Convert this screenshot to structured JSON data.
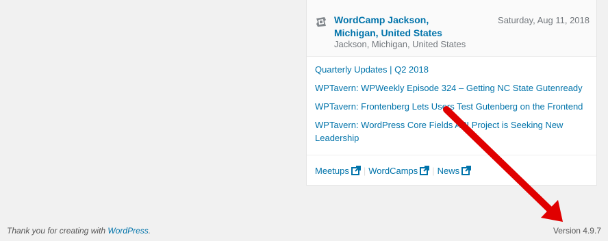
{
  "event": {
    "icon": "wordcamp-icon",
    "title": "WordCamp Jackson, Michigan, United States",
    "location": "Jackson, Michigan, United States",
    "date": "Saturday, Aug 11, 2018"
  },
  "news": [
    "Quarterly Updates | Q2 2018",
    "WPTavern: WPWeekly Episode 324 – Getting NC State Gutenready",
    "WPTavern: Frontenberg Lets Users Test Gutenberg on the Frontend",
    "WPTavern: WordPress Core Fields API Project is Seeking New Leadership"
  ],
  "links": {
    "meetups": "Meetups",
    "wordcamps": "WordCamps",
    "news": "News",
    "separator": "|",
    "icon": "external-link-icon"
  },
  "footer": {
    "thanks_prefix": "Thank you for creating with ",
    "thanks_link": "WordPress",
    "thanks_suffix": ".",
    "version": "Version 4.9.7"
  },
  "annotation": {
    "arrow_color": "#e00000",
    "icon": "red-arrow-icon"
  }
}
